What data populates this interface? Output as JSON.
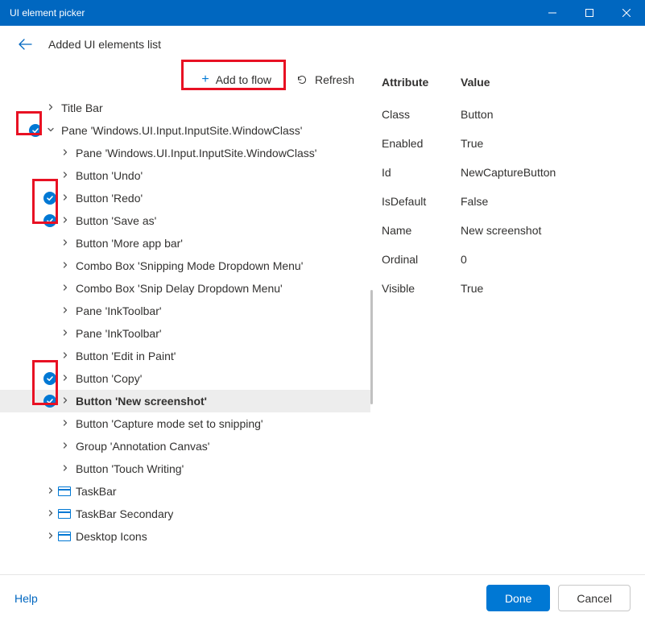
{
  "window": {
    "title": "UI element picker"
  },
  "header": {
    "title": "Added UI elements list"
  },
  "toolbar": {
    "add_label": "Add to flow",
    "refresh_label": "Refresh"
  },
  "tree": [
    {
      "indent": 0,
      "chev": "right",
      "badge": false,
      "win": false,
      "label": "Title Bar",
      "selected": false
    },
    {
      "indent": 0,
      "chev": "down",
      "badge": true,
      "win": false,
      "label": "Pane 'Windows.UI.Input.InputSite.WindowClass'",
      "selected": false
    },
    {
      "indent": 1,
      "chev": "right",
      "badge": false,
      "win": false,
      "label": "Pane 'Windows.UI.Input.InputSite.WindowClass'",
      "selected": false
    },
    {
      "indent": 1,
      "chev": "right",
      "badge": false,
      "win": false,
      "label": "Button 'Undo'",
      "selected": false
    },
    {
      "indent": 1,
      "chev": "right",
      "badge": true,
      "win": false,
      "label": "Button 'Redo'",
      "selected": false
    },
    {
      "indent": 1,
      "chev": "right",
      "badge": true,
      "win": false,
      "label": "Button 'Save as'",
      "selected": false
    },
    {
      "indent": 1,
      "chev": "right",
      "badge": false,
      "win": false,
      "label": "Button 'More app bar'",
      "selected": false
    },
    {
      "indent": 1,
      "chev": "right",
      "badge": false,
      "win": false,
      "label": "Combo Box 'Snipping Mode Dropdown Menu'",
      "selected": false
    },
    {
      "indent": 1,
      "chev": "right",
      "badge": false,
      "win": false,
      "label": "Combo Box 'Snip Delay Dropdown Menu'",
      "selected": false
    },
    {
      "indent": 1,
      "chev": "right",
      "badge": false,
      "win": false,
      "label": "Pane 'InkToolbar'",
      "selected": false
    },
    {
      "indent": 1,
      "chev": "right",
      "badge": false,
      "win": false,
      "label": "Pane 'InkToolbar'",
      "selected": false
    },
    {
      "indent": 1,
      "chev": "right",
      "badge": false,
      "win": false,
      "label": "Button 'Edit in Paint'",
      "selected": false
    },
    {
      "indent": 1,
      "chev": "right",
      "badge": true,
      "win": false,
      "label": "Button 'Copy'",
      "selected": false
    },
    {
      "indent": 1,
      "chev": "right",
      "badge": true,
      "win": false,
      "label": "Button 'New screenshot'",
      "selected": true
    },
    {
      "indent": 1,
      "chev": "right",
      "badge": false,
      "win": false,
      "label": "Button 'Capture mode set to snipping'",
      "selected": false
    },
    {
      "indent": 1,
      "chev": "right",
      "badge": false,
      "win": false,
      "label": "Group 'Annotation Canvas'",
      "selected": false
    },
    {
      "indent": 1,
      "chev": "right",
      "badge": false,
      "win": false,
      "label": "Button 'Touch Writing'",
      "selected": false
    },
    {
      "indent": 0,
      "chev": "right",
      "badge": false,
      "win": true,
      "label": "TaskBar",
      "selected": false
    },
    {
      "indent": 0,
      "chev": "right",
      "badge": false,
      "win": true,
      "label": "TaskBar Secondary",
      "selected": false
    },
    {
      "indent": 0,
      "chev": "right",
      "badge": false,
      "win": true,
      "label": "Desktop Icons",
      "selected": false
    }
  ],
  "attributes": {
    "header_attr": "Attribute",
    "header_val": "Value",
    "rows": [
      {
        "attr": "Class",
        "val": "Button"
      },
      {
        "attr": "Enabled",
        "val": "True"
      },
      {
        "attr": "Id",
        "val": "NewCaptureButton"
      },
      {
        "attr": "IsDefault",
        "val": "False"
      },
      {
        "attr": "Name",
        "val": "New screenshot"
      },
      {
        "attr": "Ordinal",
        "val": "0"
      },
      {
        "attr": "Visible",
        "val": "True"
      }
    ]
  },
  "footer": {
    "help": "Help",
    "done": "Done",
    "cancel": "Cancel"
  }
}
